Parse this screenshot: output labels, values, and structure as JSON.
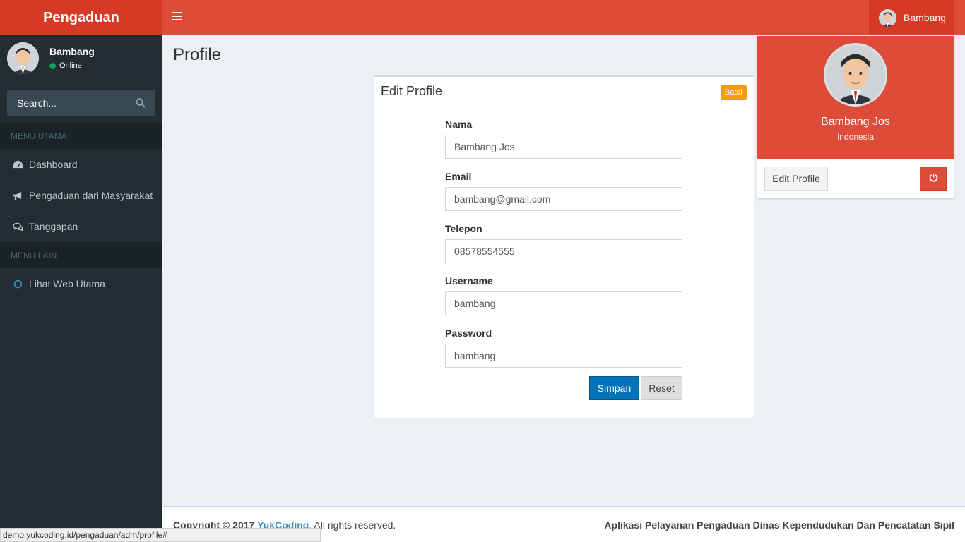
{
  "app": {
    "brand": "Pengaduan"
  },
  "header": {
    "user_name": "Bambang"
  },
  "sidebar": {
    "user_name": "Bambang",
    "status": "Online",
    "search_placeholder": "Search...",
    "sections": [
      {
        "label": "MENU UTAMA"
      },
      {
        "label": "MENU LAIN"
      }
    ],
    "items": [
      {
        "label": "Dashboard",
        "icon": "dashboard-icon"
      },
      {
        "label": "Pengaduan dari Masyarakat",
        "icon": "bullhorn-icon"
      },
      {
        "label": "Tanggapan",
        "icon": "comments-icon"
      },
      {
        "label": "Lihat Web Utama",
        "icon": "circle-icon"
      }
    ]
  },
  "page": {
    "title": "Profile"
  },
  "form": {
    "title": "Edit Profile",
    "cancel_label": "Batal",
    "fields": [
      {
        "label": "Nama",
        "value": "Bambang Jos"
      },
      {
        "label": "Email",
        "value": "bambang@gmail.com"
      },
      {
        "label": "Telepon",
        "value": "08578554555"
      },
      {
        "label": "Username",
        "value": "bambang"
      },
      {
        "label": "Password",
        "value": "bambang"
      }
    ],
    "submit_label": "Simpan",
    "reset_label": "Reset"
  },
  "profile_dropdown": {
    "name": "Bambang Jos",
    "subtitle": "Indonesia",
    "edit_label": "Edit Profile"
  },
  "footer": {
    "copyright_prefix": "Copyright © 2017",
    "company": "YukCoding",
    "copyright_suffix": ". All rights reserved.",
    "app_name": "Aplikasi Pelayanan Pengaduan Dinas Kependudukan Dan Pencatatan Sipil"
  },
  "statusbar": {
    "url": "demo.yukcoding.id/pengaduan/adm/profile#"
  },
  "colors": {
    "header": "#dd4b39",
    "sidebar": "#222d32",
    "primary": "#0073b7",
    "warning": "#f39c12"
  }
}
